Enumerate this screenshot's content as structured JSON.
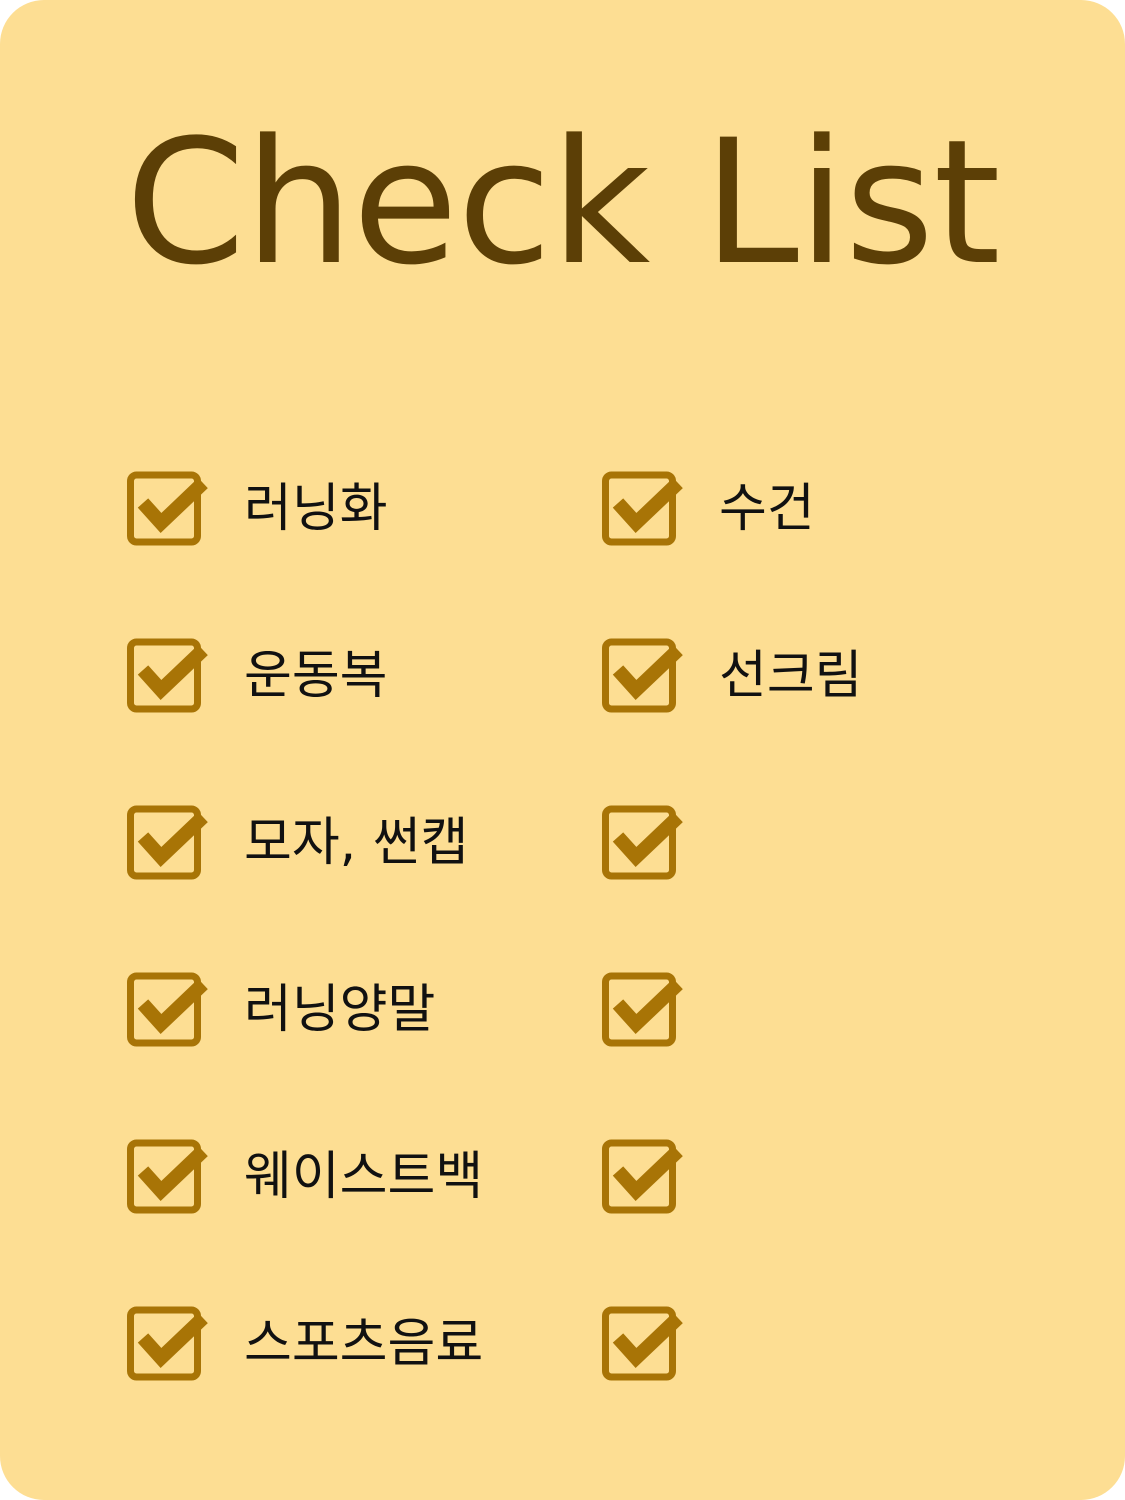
{
  "title": "Check List",
  "colors": {
    "background": "#FDDE93",
    "title": "#5C3F06",
    "checkbox": "#A87406",
    "text": "#111111"
  },
  "checklist": {
    "left": [
      {
        "label": "러닝화",
        "checked": true,
        "icon": "checkbox-checked-icon"
      },
      {
        "label": "운동복",
        "checked": true,
        "icon": "checkbox-checked-icon"
      },
      {
        "label": "모자, 썬캡",
        "checked": true,
        "icon": "checkbox-checked-icon"
      },
      {
        "label": "러닝양말",
        "checked": true,
        "icon": "checkbox-checked-icon"
      },
      {
        "label": "웨이스트백",
        "checked": true,
        "icon": "checkbox-checked-icon"
      },
      {
        "label": "스포츠음료",
        "checked": true,
        "icon": "checkbox-checked-icon"
      }
    ],
    "right": [
      {
        "label": "수건",
        "checked": true,
        "icon": "checkbox-checked-icon"
      },
      {
        "label": "선크림",
        "checked": true,
        "icon": "checkbox-checked-icon"
      },
      {
        "label": "",
        "checked": true,
        "icon": "checkbox-checked-icon"
      },
      {
        "label": "",
        "checked": true,
        "icon": "checkbox-checked-icon"
      },
      {
        "label": "",
        "checked": true,
        "icon": "checkbox-checked-icon"
      },
      {
        "label": "",
        "checked": true,
        "icon": "checkbox-checked-icon"
      }
    ]
  }
}
